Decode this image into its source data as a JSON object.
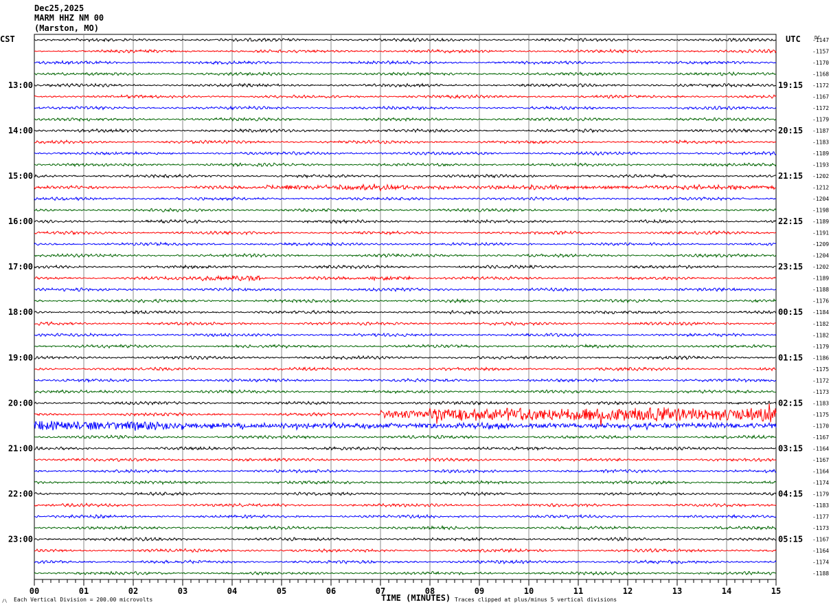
{
  "header": {
    "date": "Dec25,2025",
    "station": "MARM HHZ NM 00",
    "location": "(Marston, MO)"
  },
  "left_timezone": "CST",
  "right_timezone": "UTC",
  "dc_label": "DC",
  "footer": {
    "scale": "Each Vertical Division =  200.00 microvolts",
    "xlabel": "TIME (MINUTES)",
    "clip_note": "Traces clipped at plus/minus 5 vertical divisions"
  },
  "chart_data": {
    "type": "line",
    "subtype": "helicorder",
    "xlabel": "TIME (MINUTES)",
    "xlim": [
      0,
      15
    ],
    "x_tick_labels": [
      "00",
      "01",
      "02",
      "03",
      "04",
      "05",
      "06",
      "07",
      "08",
      "09",
      "10",
      "11",
      "12",
      "13",
      "14",
      "15"
    ],
    "minutes_per_line": 15,
    "trace_colors": [
      "#000000",
      "#ff0000",
      "#0000ff",
      "#006400"
    ],
    "grid": "vertical lines each minute",
    "left_hour_labels": [
      {
        "row": 4,
        "label": "13:00"
      },
      {
        "row": 8,
        "label": "14:00"
      },
      {
        "row": 12,
        "label": "15:00"
      },
      {
        "row": 16,
        "label": "16:00"
      },
      {
        "row": 20,
        "label": "17:00"
      },
      {
        "row": 24,
        "label": "18:00"
      },
      {
        "row": 28,
        "label": "19:00"
      },
      {
        "row": 32,
        "label": "20:00"
      },
      {
        "row": 36,
        "label": "21:00"
      },
      {
        "row": 40,
        "label": "22:00"
      },
      {
        "row": 44,
        "label": "23:00"
      }
    ],
    "right_hour_labels": [
      {
        "row": 4,
        "label": "19:15"
      },
      {
        "row": 8,
        "label": "20:15"
      },
      {
        "row": 12,
        "label": "21:15"
      },
      {
        "row": 16,
        "label": "22:15"
      },
      {
        "row": 20,
        "label": "23:15"
      },
      {
        "row": 24,
        "label": "00:15"
      },
      {
        "row": 28,
        "label": "01:15"
      },
      {
        "row": 32,
        "label": "02:15"
      },
      {
        "row": 36,
        "label": "03:15"
      },
      {
        "row": 40,
        "label": "04:15"
      },
      {
        "row": 44,
        "label": "05:15"
      }
    ],
    "dc_offsets": [
      -1147,
      -1157,
      -1170,
      -1168,
      -1172,
      -1167,
      -1172,
      -1179,
      -1187,
      -1183,
      -1189,
      -1193,
      -1202,
      -1212,
      -1204,
      -1198,
      -1189,
      -1191,
      -1209,
      -1204,
      -1202,
      -1189,
      -1188,
      -1176,
      -1184,
      -1182,
      -1182,
      -1179,
      -1186,
      -1175,
      -1172,
      -1173,
      -1183,
      -1175,
      -1170,
      -1167,
      -1164,
      -1167,
      -1164,
      -1174,
      -1179,
      -1183,
      -1177,
      -1173,
      -1167,
      -1164,
      -1174,
      -1188
    ],
    "events": [
      {
        "row": 13,
        "start_min": 4.7,
        "end_min": 7.4,
        "amplitude_div": 0.9
      },
      {
        "row": 13,
        "start_min": 7.4,
        "end_min": 15,
        "amplitude_div": 0.55
      },
      {
        "row": 21,
        "start_min": 3.4,
        "end_min": 4.6,
        "amplitude_div": 1.0
      },
      {
        "row": 21,
        "start_min": 6.8,
        "end_min": 7.6,
        "amplitude_div": 0.7
      },
      {
        "row": 33,
        "start_min": 7.0,
        "end_min": 8.0,
        "amplitude_div": 1.6
      },
      {
        "row": 33,
        "start_min": 8.0,
        "end_min": 15,
        "amplitude_div": 2.6
      },
      {
        "row": 34,
        "start_min": 0,
        "end_min": 2.5,
        "amplitude_div": 1.8
      },
      {
        "row": 34,
        "start_min": 2.5,
        "end_min": 15,
        "amplitude_div": 0.9
      }
    ]
  }
}
